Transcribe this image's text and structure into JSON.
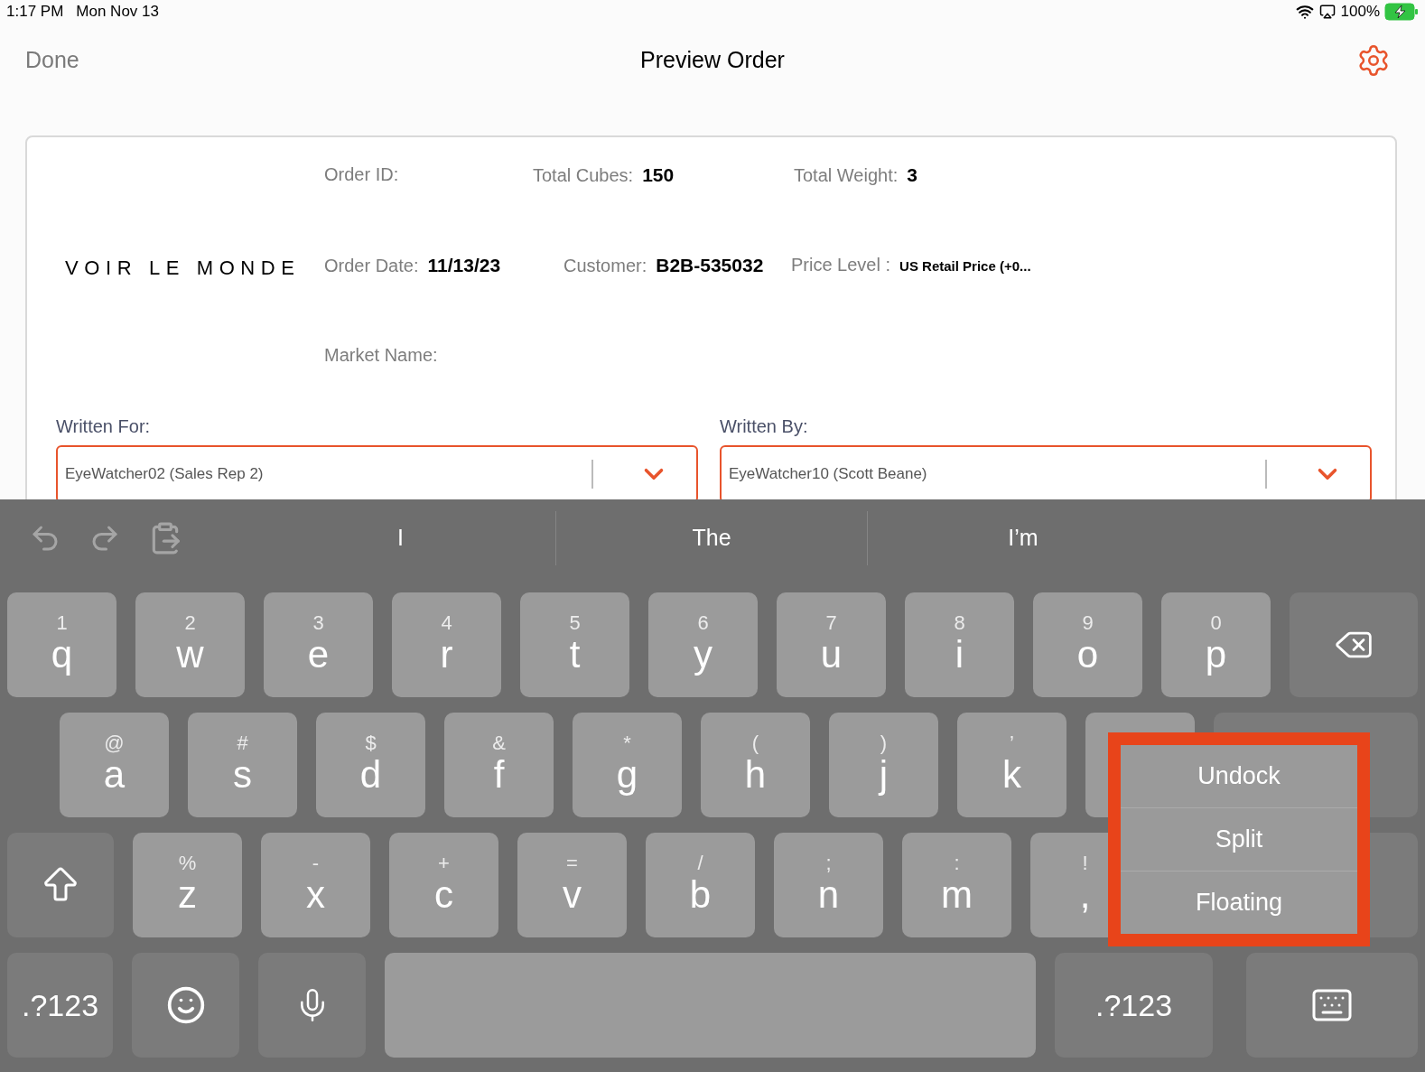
{
  "status_bar": {
    "time": "1:17 PM",
    "date": "Mon Nov 13",
    "battery": "100%"
  },
  "nav": {
    "done": "Done",
    "title": "Preview Order"
  },
  "order": {
    "logo": "VOIR LE MONDE",
    "field_rows": [
      [
        {
          "label": "Order ID:"
        },
        {
          "label": "Total Cubes:",
          "value": "150"
        },
        {
          "label": "Total Weight:",
          "value": "3"
        }
      ],
      [
        {
          "label": "Order Date:",
          "value": "11/13/23"
        },
        {
          "label": "Customer:",
          "value": "B2B-535032"
        },
        {
          "label": "Price Level :",
          "value": "US Retail Price (+0..."
        }
      ],
      [
        {
          "label": "Market Name:"
        }
      ]
    ],
    "selects": [
      {
        "label": "Written For:",
        "value": "EyeWatcher02 (Sales Rep 2)"
      },
      {
        "label": "Written By:",
        "value": "EyeWatcher10 (Scott Beane)"
      }
    ]
  },
  "keyboard": {
    "suggestions": [
      "I",
      "The",
      "I’m"
    ],
    "rows": [
      [
        {
          "kind": "letter",
          "hint": "1",
          "label": "q"
        },
        {
          "kind": "letter",
          "hint": "2",
          "label": "w"
        },
        {
          "kind": "letter",
          "hint": "3",
          "label": "e"
        },
        {
          "kind": "letter",
          "hint": "4",
          "label": "r"
        },
        {
          "kind": "letter",
          "hint": "5",
          "label": "t"
        },
        {
          "kind": "letter",
          "hint": "6",
          "label": "y"
        },
        {
          "kind": "letter",
          "hint": "7",
          "label": "u"
        },
        {
          "kind": "letter",
          "hint": "8",
          "label": "i"
        },
        {
          "kind": "letter",
          "hint": "9",
          "label": "o"
        },
        {
          "kind": "letter",
          "hint": "0",
          "label": "p"
        },
        {
          "kind": "backspace"
        }
      ],
      [
        {
          "kind": "letter",
          "hint": "@",
          "label": "a"
        },
        {
          "kind": "letter",
          "hint": "#",
          "label": "s"
        },
        {
          "kind": "letter",
          "hint": "$",
          "label": "d"
        },
        {
          "kind": "letter",
          "hint": "&",
          "label": "f"
        },
        {
          "kind": "letter",
          "hint": "*",
          "label": "g"
        },
        {
          "kind": "letter",
          "hint": "(",
          "label": "h"
        },
        {
          "kind": "letter",
          "hint": ")",
          "label": "j"
        },
        {
          "kind": "letter",
          "hint": "’",
          "label": "k"
        },
        {
          "kind": "blank"
        },
        {
          "kind": "blank_wide"
        }
      ],
      [
        {
          "kind": "shift"
        },
        {
          "kind": "letter",
          "hint": "%",
          "label": "z"
        },
        {
          "kind": "letter",
          "hint": "-",
          "label": "x"
        },
        {
          "kind": "letter",
          "hint": "+",
          "label": "c"
        },
        {
          "kind": "letter",
          "hint": "=",
          "label": "v"
        },
        {
          "kind": "letter",
          "hint": "/",
          "label": "b"
        },
        {
          "kind": "letter",
          "hint": ";",
          "label": "n"
        },
        {
          "kind": "letter",
          "hint": ":",
          "label": "m"
        },
        {
          "kind": "letter",
          "hint": "!",
          "label": ","
        },
        {
          "kind": "blank_wide"
        }
      ],
      [
        {
          "kind": "symbols",
          "label": ".?123"
        },
        {
          "kind": "emoji"
        },
        {
          "kind": "mic"
        },
        {
          "kind": "space"
        },
        {
          "kind": "symbols",
          "label": ".?123"
        },
        {
          "kind": "dismiss"
        }
      ]
    ]
  },
  "menu": {
    "highlighted": true,
    "items": [
      "Undock",
      "Split",
      "Floating"
    ]
  }
}
